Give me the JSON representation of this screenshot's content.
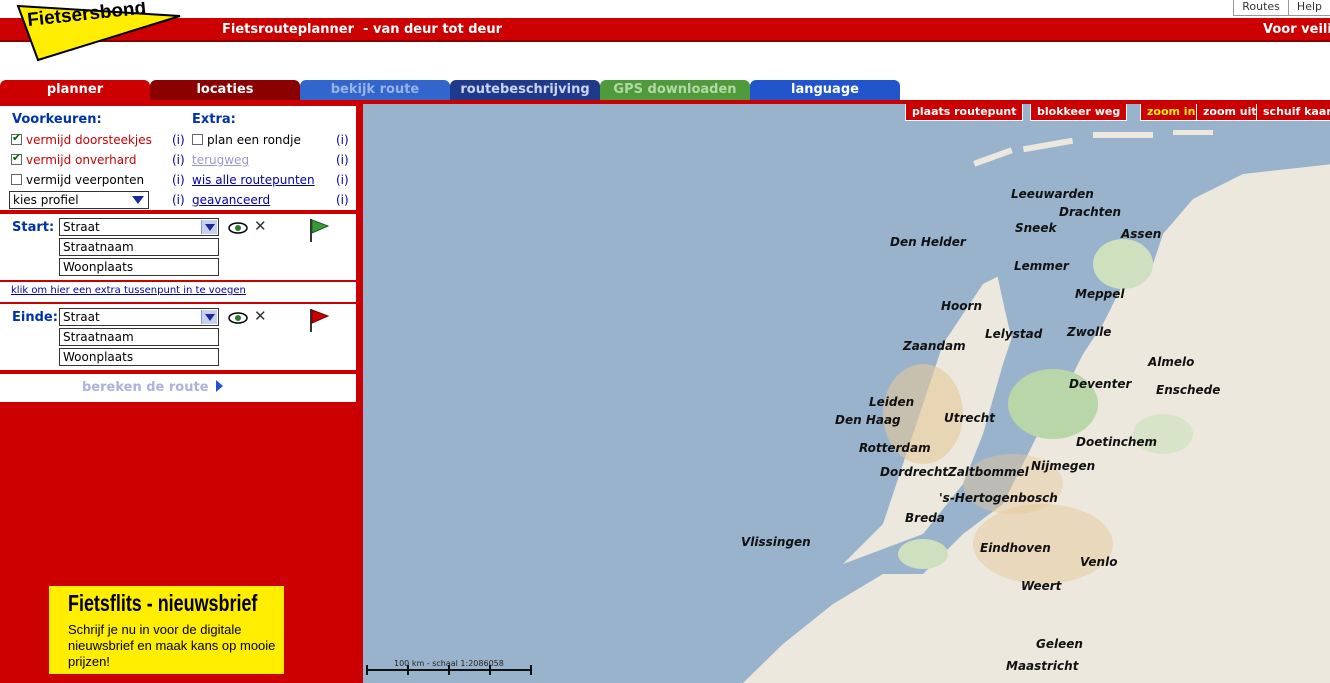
{
  "header": {
    "logo_text": "Fietsersbond",
    "subtitle": "Fietsrouteplanner  - van deur tot deur",
    "tagline": "Voor veilig",
    "top_links": [
      "Routes",
      "Help"
    ]
  },
  "tabs": [
    {
      "label": "planner"
    },
    {
      "label": "locaties"
    },
    {
      "label": "bekijk route"
    },
    {
      "label": "routebeschrijving"
    },
    {
      "label": "GPS downloaden"
    },
    {
      "label": "language"
    }
  ],
  "prefs": {
    "voorkeuren_label": "Voorkeuren:",
    "extra_label": "Extra:",
    "vermijd_doorsteekjes": "vermijd doorsteekjes",
    "vermijd_onverhard": "vermijd onverhard",
    "vermijd_veerponten": "vermijd veerponten",
    "profiel_select": "kies profiel",
    "plan_rondje": "plan een rondje",
    "terugweg": "terugweg",
    "wis_routepunten": "wis alle routepunten",
    "geavanceerd": "geavanceerd",
    "info": "(i)"
  },
  "start": {
    "label": "Start:",
    "type_select": "Straat",
    "street_value": "Straatnaam",
    "city_value": "Woonplaats"
  },
  "tussenpunt_link": "klik om hier een extra tussenpunt in te voegen",
  "einde": {
    "label": "Einde:",
    "type_select": "Straat",
    "street_value": "Straatnaam",
    "city_value": "Woonplaats"
  },
  "bereken_label": "bereken de route",
  "newsletter": {
    "title": "Fietsflits - nieuwsbrief",
    "text": "Schrijf je nu in voor de digitale nieuwsbrief en maak kans op mooie prijzen!"
  },
  "map": {
    "buttons": {
      "plaats": "plaats routepunt",
      "blokkeer": "blokkeer weg",
      "zoom_in": "zoom in",
      "zoom_uit": "zoom uit",
      "schuif": "schuif kaart"
    },
    "scale_text": "100 km - schaal 1:2086058",
    "cities": {
      "leeuwarden": "Leeuwarden",
      "drachten": "Drachten",
      "sneek": "Sneek",
      "assen": "Assen",
      "den_helder": "Den Helder",
      "lemmer": "Lemmer",
      "meppel": "Meppel",
      "hoorn": "Hoorn",
      "lelystad": "Lelystad",
      "zwolle": "Zwolle",
      "zaandam": "Zaandam",
      "almelo": "Almelo",
      "deventer": "Deventer",
      "enschede": "Enschede",
      "leiden": "Leiden",
      "den_haag": "Den Haag",
      "utrecht": "Utrecht",
      "doetinchem": "Doetinchem",
      "rotterdam": "Rotterdam",
      "dordrecht": "Dordrecht",
      "zaltbommel": "Zaltbommel",
      "nijmegen": "Nijmegen",
      "hertogenbosch": "'s-Hertogenbosch",
      "breda": "Breda",
      "vlissingen": "Vlissingen",
      "eindhoven": "Eindhoven",
      "venlo": "Venlo",
      "weert": "Weert",
      "geleen": "Geleen",
      "maastricht": "Maastricht"
    }
  }
}
